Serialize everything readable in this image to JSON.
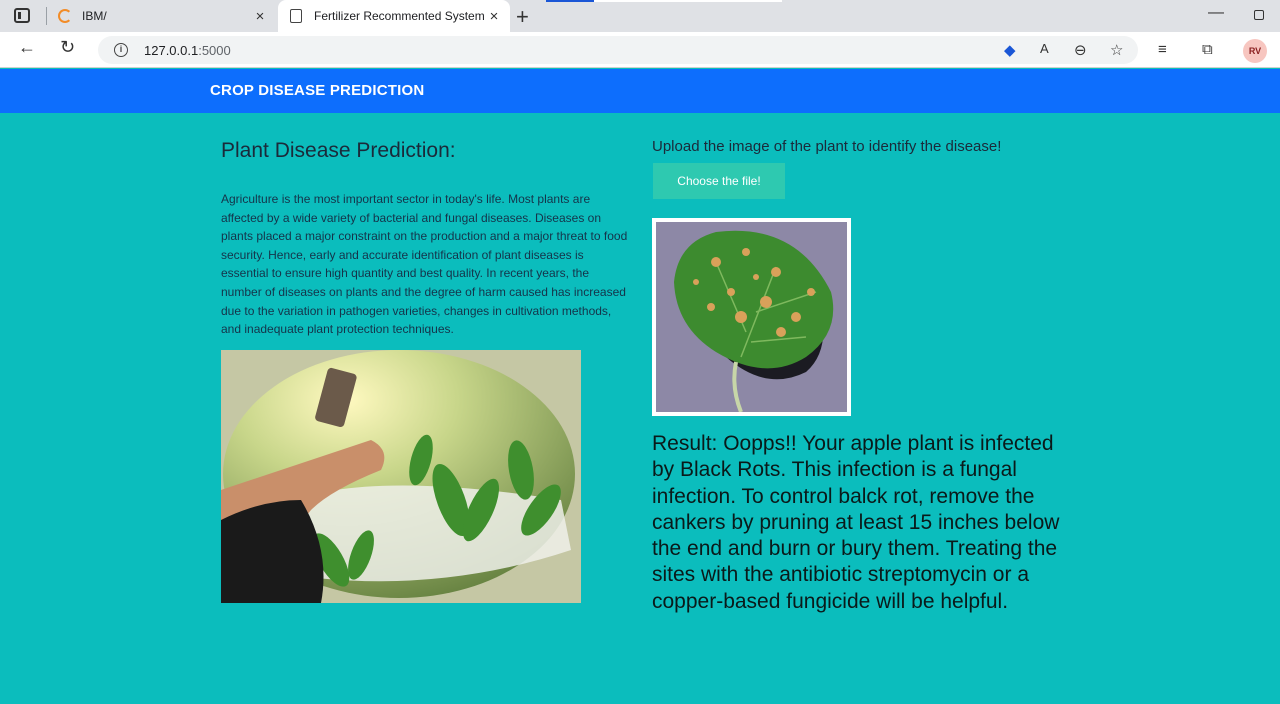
{
  "browser": {
    "tabs": [
      {
        "title": "IBM/",
        "close": "×"
      },
      {
        "title": "Fertilizer Recommented System a",
        "close": "×"
      }
    ],
    "new_tab": "+",
    "url_host": "127.0.0.1",
    "url_port": ":5000",
    "profile_initials": "RV",
    "icons": [
      "window-icon",
      "back-arrow-icon",
      "reload-icon",
      "info-icon",
      "tag-icon",
      "read-aloud-icon",
      "zoom-out-icon",
      "favorite-add-icon",
      "favorites-icon",
      "collections-icon"
    ]
  },
  "navbar": {
    "brand": "CROP DISEASE PREDICTION"
  },
  "left": {
    "title": "Plant Disease Prediction:",
    "description": "Agriculture is the most important sector in today's life. Most plants are affected by a wide variety of bacterial and fungal diseases. Diseases on plants placed a major constraint on the production and a major threat to food security. Hence, early and accurate identification of plant diseases is essential to ensure high quantity and best quality. In recent years, the number of diseases on plants and the degree of harm caused has increased due to the variation in pathogen varieties, changes in cultivation methods, and inadequate plant protection techniques."
  },
  "right": {
    "upload_label": "Upload the image of the plant to identify the disease!",
    "choose_button": "Choose the file!",
    "result": "Result: Oopps!! Your apple plant is infected by Black Rots. This infection is a fungal infection. To control balck rot, remove the cankers by pruning at least 15 inches below the end and burn or bury them. Treating the sites with the antibiotic streptomycin or a copper-based fungicide will be helpful."
  },
  "colors": {
    "page_bg": "#0bbdbd",
    "navbar": "#0d6efd",
    "button": "#2ec9b0"
  }
}
